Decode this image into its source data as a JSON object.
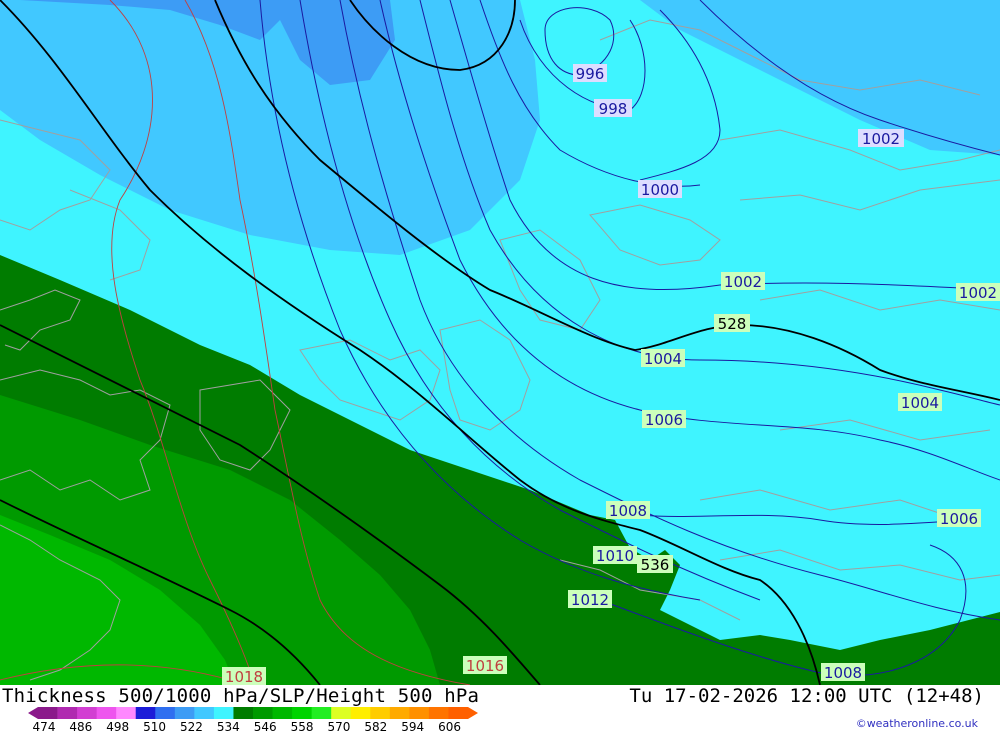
{
  "title": "Thickness 500/1000 hPa/SLP/Height 500 hPa",
  "valid_time": "Tu 17-02-2026 12:00 UTC (12+48)",
  "credit": "©weatheronline.co.uk",
  "legend": {
    "ticks": [
      "474",
      "486",
      "498",
      "510",
      "522",
      "534",
      "546",
      "558",
      "570",
      "582",
      "594",
      "606"
    ],
    "colors": [
      "#8b1a8b",
      "#b02ab0",
      "#d23ed2",
      "#ee55ee",
      "#ff88ff",
      "#1c1cd8",
      "#2f6ff0",
      "#3d9cf5",
      "#41c8ff",
      "#3ff4ff",
      "#007c00",
      "#009a00",
      "#00b800",
      "#00d400",
      "#22ee22",
      "#ddff22",
      "#ffee00",
      "#ffcc00",
      "#ffaa00",
      "#ff9000",
      "#ff7400",
      "#ff6000"
    ]
  },
  "slp_labels": {
    "l996": "996",
    "l998": "998",
    "l1000": "1000",
    "l1002_ne": "1002",
    "l1002_c": "1002",
    "l1002_e": "1002",
    "l1004_c": "1004",
    "l1004_e": "1004",
    "l1006_c": "1006",
    "l1006_e": "1006",
    "l1008_c": "1008",
    "l1008_s": "1008",
    "l1010": "1010",
    "l1012": "1012",
    "l1016": "1016",
    "l1018": "1018"
  },
  "height_labels": {
    "h528": "528",
    "h536": "536"
  },
  "colors": {
    "cyan": "#3ff4ff",
    "blue_light": "#41c8ff",
    "blue_mid": "#3d9cf5",
    "green_dark": "#007c00",
    "green_mid": "#009a00",
    "green_light": "#00b800",
    "isobar": "#1a1aa0",
    "height": "#000000",
    "coast": "#a0a0a0",
    "label_blue_bg": "#ddddff",
    "label_green_bg": "#ccffbb"
  }
}
